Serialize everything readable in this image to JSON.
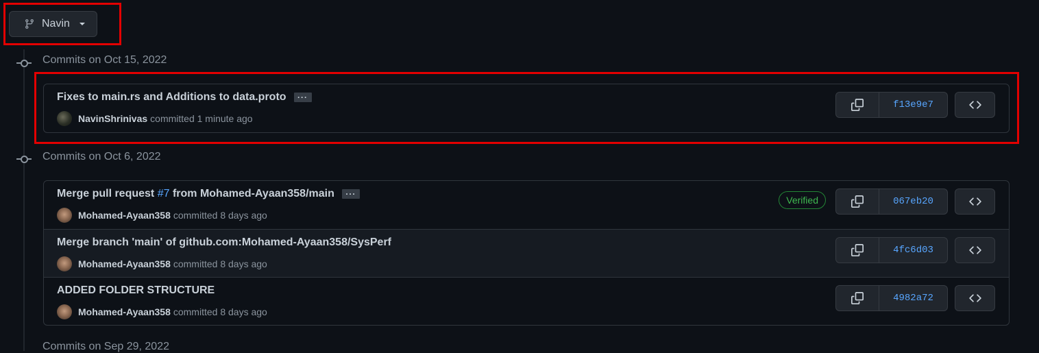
{
  "branch": {
    "name": "Navin",
    "icon": "git-branch-icon"
  },
  "groups": [
    {
      "heading": "Commits on Oct 15, 2022",
      "commits": [
        {
          "message": "Fixes to main.rs and Additions to data.proto",
          "author": "NavinShrinivas",
          "action": "committed",
          "when": "1 minute ago",
          "sha": "f13e9e7",
          "verified": ""
        }
      ]
    },
    {
      "heading": "Commits on Oct 6, 2022",
      "commits": [
        {
          "message_pre": "Merge pull request",
          "message_link": "#7",
          "message_post": "from Mohamed-Ayaan358/main",
          "author": "Mohamed-Ayaan358",
          "action": "committed",
          "when": "8 days ago",
          "sha": "067eb20",
          "verified": "Verified"
        },
        {
          "message": "Merge branch 'main' of github.com:Mohamed-Ayaan358/SysPerf",
          "author": "Mohamed-Ayaan358",
          "action": "committed",
          "when": "8 days ago",
          "sha": "4fc6d03",
          "verified": ""
        },
        {
          "message": "ADDED FOLDER STRUCTURE",
          "author": "Mohamed-Ayaan358",
          "action": "committed",
          "when": "8 days ago",
          "sha": "4982a72",
          "verified": ""
        }
      ]
    },
    {
      "heading": "Commits on Sep 29, 2022"
    }
  ],
  "icons": {
    "copy": "copy-icon",
    "browse": "code-icon",
    "ellipsis": "kebab-horizontal-icon",
    "caret": "triangle-down-icon",
    "commit_node": "git-commit-icon"
  },
  "colors": {
    "background": "#0d1117",
    "link": "#58a6ff",
    "verified": "#3fb950",
    "annotation": "#e30000"
  }
}
